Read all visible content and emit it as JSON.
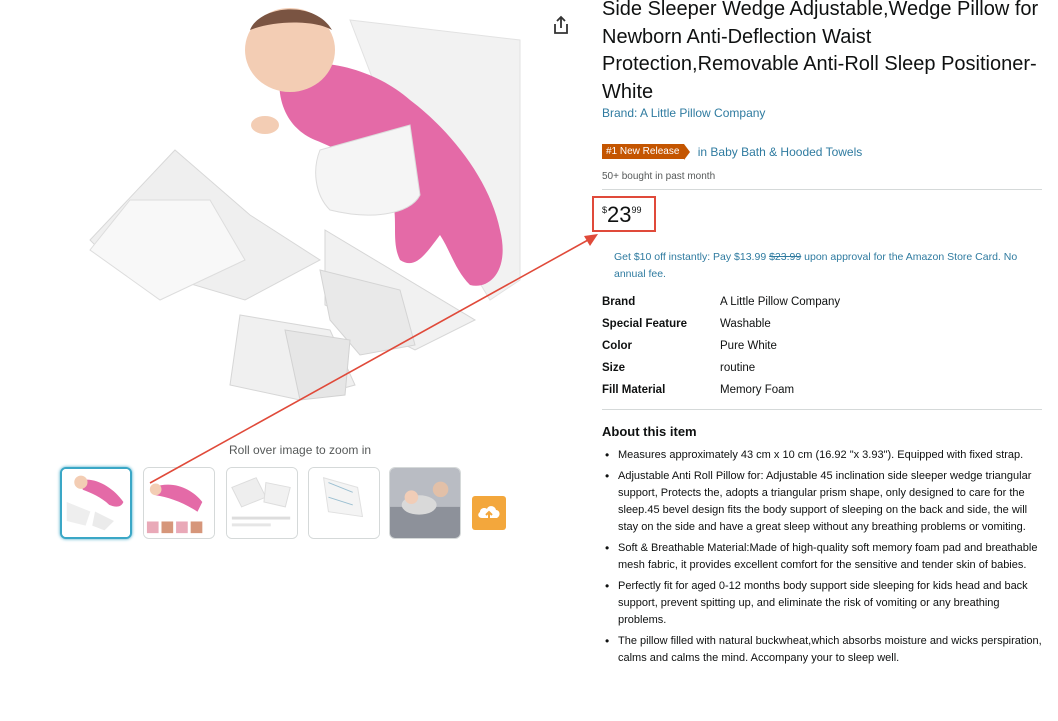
{
  "product": {
    "title": "Side Sleeper Wedge Adjustable,Wedge Pillow for Newborn Anti-Deflection Waist Protection,Removable Anti-Roll Sleep Positioner-White",
    "brand_link": "Brand: A Little Pillow Company",
    "badge": "#1 New Release",
    "badge_category": "in Baby Bath & Hooded Towels",
    "bought": "50+ bought in past month"
  },
  "price": {
    "symbol": "$",
    "whole": "23",
    "fraction": "99"
  },
  "promo": {
    "lead": "Get $10 off instantly: Pay $13.99",
    "strike": "$23.99",
    "tail": "upon approval for the Amazon Store Card. No annual fee."
  },
  "specs": [
    {
      "key": "Brand",
      "value": "A Little Pillow Company"
    },
    {
      "key": "Special Feature",
      "value": "Washable"
    },
    {
      "key": "Color",
      "value": "Pure White"
    },
    {
      "key": "Size",
      "value": "routine"
    },
    {
      "key": "Fill Material",
      "value": "Memory Foam"
    }
  ],
  "about": {
    "title": "About this item",
    "bullets": [
      "Measures approximately 43 cm x 10 cm (16.92 \"x 3.93\"). Equipped with fixed strap.",
      "Adjustable Anti Roll Pillow for: Adjustable 45 inclination side sleeper wedge triangular support, Protects the, adopts a triangular prism shape, only designed to care for the sleep.45 bevel design fits the body support of sleeping on the back and side, the will stay on the side and have a great sleep without any breathing problems or vomiting.",
      "Soft & Breathable Material:Made of high-quality soft memory foam pad and breathable mesh fabric, it provides excellent comfort for the sensitive and tender skin of babies.",
      "Perfectly fit for aged 0-12 months body support side sleeping for kids head and back support, prevent spitting up, and eliminate the risk of vomiting or any breathing problems.",
      "The pillow filled with natural buckwheat,which absorbs moisture and wicks perspiration, calms and calms the mind. Accompany your to sleep well."
    ]
  },
  "gallery": {
    "zoom_hint": "Roll over image to zoom in",
    "thumbnails": [
      "thumbnail-1",
      "thumbnail-2",
      "thumbnail-3",
      "thumbnail-4",
      "thumbnail-5"
    ],
    "selected_index": 0
  },
  "icons": {
    "share": "share-icon",
    "upload": "cloud-upload-icon"
  },
  "colors": {
    "link": "#2f7ba0",
    "badge": "#c45500",
    "annotation": "#e04a3a",
    "upload_button": "#f3a73c",
    "thumb_selected": "#3aa7c6"
  }
}
